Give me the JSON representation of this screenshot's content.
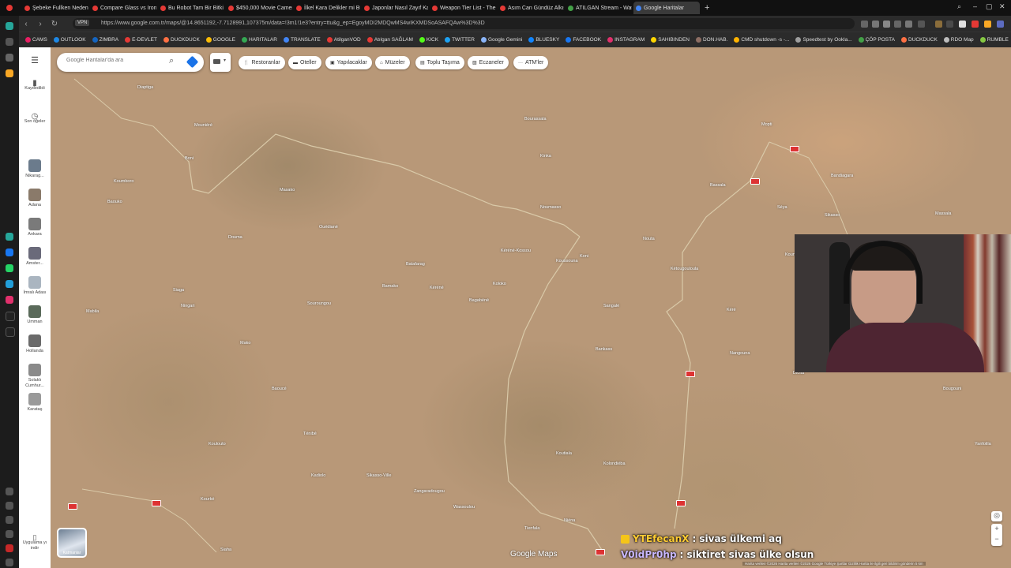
{
  "browser": {
    "tabs": [
      {
        "title": "Şebeke Fullken Neden İni",
        "color": "#e53935"
      },
      {
        "title": "Compare Glass vs Iron - Y",
        "color": "#e53935"
      },
      {
        "title": "Bu Robot Tam Bir Bitki Gi",
        "color": "#e53935"
      },
      {
        "title": "$450,000 Movie Camera",
        "color": "#e53935"
      },
      {
        "title": "İlkel Kara Delikler mi Bulu",
        "color": "#e53935"
      },
      {
        "title": "Japonlar Nasıl Zayıf Kalıy",
        "color": "#e53935"
      },
      {
        "title": "Weapon Tier List - The Fo",
        "color": "#e53935"
      },
      {
        "title": "Asım Can Gündüz Alkışla",
        "color": "#e53935"
      },
      {
        "title": "ATILGAN Stream - Watch",
        "color": "#43a047"
      },
      {
        "title": "Google Haritalar",
        "color": "#4285f4",
        "active": true
      }
    ],
    "new_tab": "+",
    "url": "https://www.google.com.tr/maps/@14.8651192,-7.7128991,107375m/data=!3m1!1e3?entry=ttu&g_ep=EgoyMDI2MDQwMS4wIKXMDSoASAFQAw%3D%3D",
    "vpn_label": "VPN",
    "bookmarks": [
      {
        "label": "CAMS",
        "color": "#e91e63"
      },
      {
        "label": "OUTLOOK",
        "color": "#1e88e5"
      },
      {
        "label": "ZIMBRA",
        "color": "#1565c0"
      },
      {
        "label": "E-DEVLET",
        "color": "#e53935"
      },
      {
        "label": "DUCKDUCK",
        "color": "#ff7043"
      },
      {
        "label": "GOOGLE",
        "color": "#fbbc05"
      },
      {
        "label": "HARITALAR",
        "color": "#34a853"
      },
      {
        "label": "TRANSLATE",
        "color": "#4285f4"
      },
      {
        "label": "AtilganVOD",
        "color": "#e53935"
      },
      {
        "label": "Atılgan SAĞLAM",
        "color": "#e53935"
      },
      {
        "label": "KICK",
        "color": "#53fc18"
      },
      {
        "label": "TWITTER",
        "color": "#1da1f2"
      },
      {
        "label": "Google Gemini",
        "color": "#8ab4f8"
      },
      {
        "label": "BLUESKY",
        "color": "#1185fe"
      },
      {
        "label": "FACEBOOK",
        "color": "#1877f2"
      },
      {
        "label": "INSTAGRAM",
        "color": "#e1306c"
      },
      {
        "label": "SAHIBINDEN",
        "color": "#ffd600"
      },
      {
        "label": "DON.HAB.",
        "color": "#8d6e63"
      },
      {
        "label": "CMD shutdown -s -...",
        "color": "#ffb300"
      },
      {
        "label": "Speedtest by Ookla...",
        "color": "#9e9e9e"
      },
      {
        "label": "ÇÖP POSTA",
        "color": "#43a047"
      },
      {
        "label": "DUCKDUCK",
        "color": "#ff7043"
      },
      {
        "label": "RDO Map",
        "color": "#bdbdbd"
      },
      {
        "label": "RUMBLE",
        "color": "#85c742"
      },
      {
        "label": "REDDIT",
        "color": "#ff4500"
      }
    ]
  },
  "maps_sidebar": {
    "menu_icon": "hamburger-icon",
    "saved_label": "Kaydedildi",
    "recent_label": "Son öğeler",
    "recent_places": [
      "Nikarag...",
      "Adana",
      "Ankara",
      "Amster...",
      "İmralı Adası",
      "Umman",
      "Hollanda",
      "Solaklı Cumhur...",
      "Karataş"
    ],
    "get_app_label": "Uygulama yı indir"
  },
  "search": {
    "placeholder": "Google Haritalar'da ara"
  },
  "chips": [
    {
      "label": "Restoranlar",
      "icon": "fork-knife-icon"
    },
    {
      "label": "Oteller",
      "icon": "bed-icon"
    },
    {
      "label": "Yapılacaklar",
      "icon": "camera-icon"
    },
    {
      "label": "Müzeler",
      "icon": "museum-icon"
    },
    {
      "label": "Toplu Taşıma",
      "icon": "train-icon"
    },
    {
      "label": "Eczaneler",
      "icon": "pill-icon"
    },
    {
      "label": "ATM'ler",
      "icon": "more-icon"
    }
  ],
  "map": {
    "places": [
      "Diaptiga",
      "Boni",
      "Mouniéré",
      "Koumboro",
      "Baouko",
      "Douma",
      "Siaga",
      "Ningari",
      "Mabila",
      "Mako",
      "Baoucé",
      "Ténibé",
      "Koulouto",
      "Kourké",
      "Siaha",
      "Ouédiané",
      "Bamako",
      "Masako",
      "Souroungou",
      "Batafarag",
      "Kéréné",
      "Bagabéné",
      "Koloko",
      "Bourassala",
      "Kinka",
      "Noumasso",
      "Kéréné-Kossou",
      "Koussouna",
      "Koni",
      "Sangalé",
      "Bankass",
      "Nouta",
      "Kétougouloula",
      "Bassala",
      "Kéré",
      "Mopti",
      "Séya",
      "Kouna",
      "Bandiagara",
      "Sikasso",
      "Massala",
      "Koulikoro",
      "Ouélessébougou",
      "Bougouni",
      "Yanfolila",
      "Nangouna",
      "Dioïla",
      "Koutiala",
      "Kolondiéba",
      "Tienfala",
      "Niéna",
      "Kadiolo",
      "Sikasso-Ville",
      "Zangaradougou",
      "Wassoulou"
    ],
    "google_logo": "Google Maps",
    "attribution": "Harita verileri ©2026 Harita verileri ©2026 Google Türkiye Şartlar Gizlilik Harita ile ilgili geri bildirim gönderin 5 km"
  },
  "layer_thumb_label": "Katmanlar",
  "chat": [
    {
      "user": "YTEfecanX",
      "message": ": sivas ülkemi aq"
    },
    {
      "user": "V0idPr0hp",
      "message": ": siktiret sivas ülke olsun"
    }
  ]
}
